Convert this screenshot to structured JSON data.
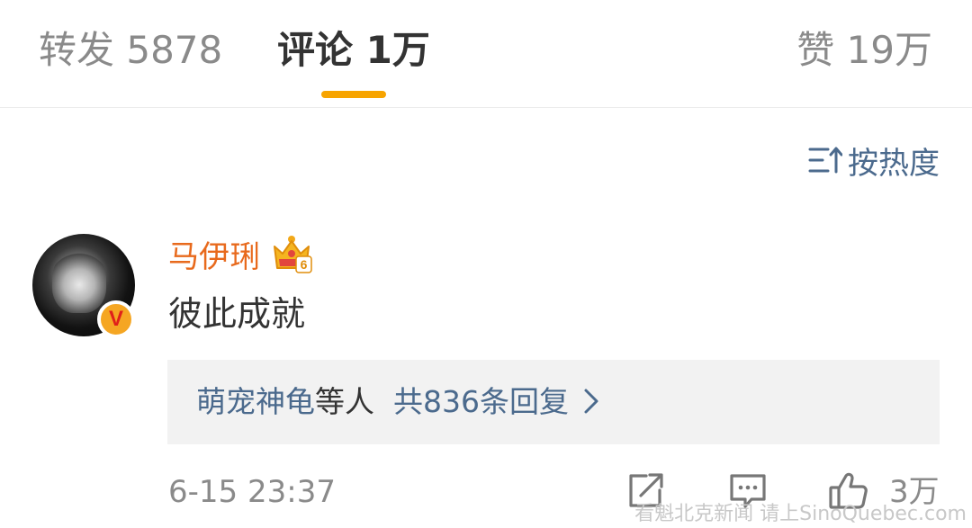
{
  "tabs": {
    "repost": "转发 5878",
    "comments": "评论 1万",
    "likes": "赞 19万",
    "active": "comments",
    "accent_color": "#f7a400"
  },
  "sort": {
    "label": "按热度",
    "icon": "sort-icon"
  },
  "comment": {
    "username": "马伊琍",
    "username_color": "#e86a1d",
    "badge_icon": "crown-level-6-icon",
    "badge_level": "6",
    "verified_mark": "V",
    "text": "彼此成就",
    "replies": {
      "names": "萌宠神龟",
      "names_suffix": "等人",
      "summary": "共836条回复",
      "link_color": "#4b6a8d"
    },
    "timestamp": "6-15 23:37",
    "actions": {
      "share_icon": "share-icon",
      "comment_icon": "comment-icon",
      "like_icon": "thumbs-up-icon",
      "like_count": "3万"
    }
  },
  "watermark": "看魁北克新闻 请上SinoQuebec.com"
}
